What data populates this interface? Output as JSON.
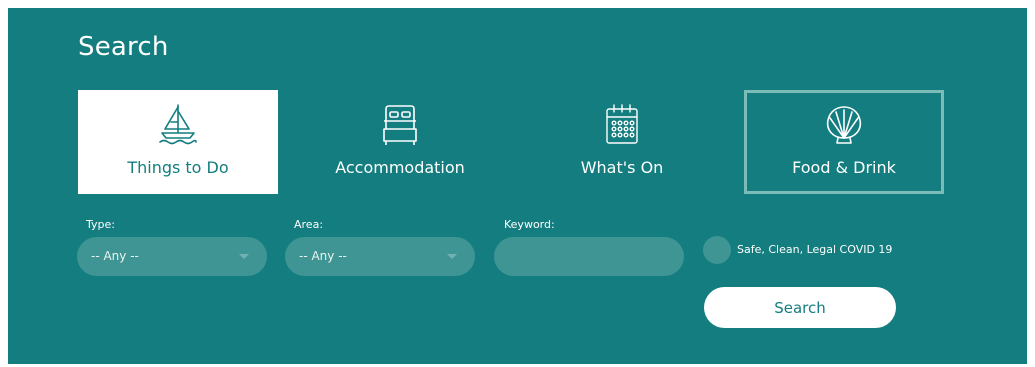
{
  "search": {
    "title": "Search"
  },
  "categories": [
    {
      "label": "Things to Do",
      "icon": "sailboat-icon",
      "state": "active"
    },
    {
      "label": "Accommodation",
      "icon": "bed-icon",
      "state": "default"
    },
    {
      "label": "What's On",
      "icon": "calendar-icon",
      "state": "default"
    },
    {
      "label": "Food & Drink",
      "icon": "shell-icon",
      "state": "outlined"
    }
  ],
  "filters": {
    "type_label": "Type:",
    "type_value": "-- Any --",
    "area_label": "Area:",
    "area_value": "-- Any --",
    "keyword_label": "Keyword:",
    "keyword_value": "",
    "covid_label": "Safe, Clean, Legal COVID 19",
    "search_button": "Search"
  },
  "colors": {
    "panel": "#137d7f",
    "field": "#3f9594",
    "outline": "#7cbcb8",
    "white": "#ffffff"
  }
}
